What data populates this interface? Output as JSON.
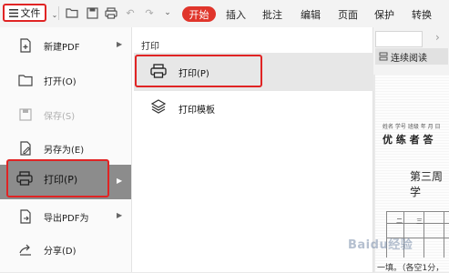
{
  "toolbar": {
    "file_label": "文件",
    "tabs": [
      "开始",
      "插入",
      "批注",
      "编辑",
      "页面",
      "保护",
      "转换"
    ],
    "icons": [
      "folder-icon",
      "save-icon",
      "print-icon",
      "undo-icon",
      "redo-icon",
      "dropdown-icon"
    ],
    "accent": "#e0352b"
  },
  "menu": {
    "items": [
      {
        "label": "新建PDF",
        "icon": "new-pdf-icon",
        "has_submenu": true
      },
      {
        "label": "打开(O)",
        "icon": "open-folder-icon",
        "has_submenu": false
      },
      {
        "label": "保存(S)",
        "icon": "save-icon",
        "has_submenu": false,
        "disabled": true
      },
      {
        "label": "另存为(E)",
        "icon": "save-as-icon",
        "has_submenu": false
      },
      {
        "label": "打印(P)",
        "icon": "print-icon",
        "has_submenu": true,
        "active": true
      },
      {
        "label": "导出PDF为",
        "icon": "export-pdf-icon",
        "has_submenu": true
      },
      {
        "label": "分享(D)",
        "icon": "share-icon",
        "has_submenu": false
      }
    ]
  },
  "submenu": {
    "title": "打印",
    "items": [
      {
        "label": "打印(P)",
        "icon": "print-icon",
        "highlighted": true
      },
      {
        "label": "打印模板",
        "icon": "layers-icon"
      }
    ]
  },
  "document": {
    "view_mode_label": "连续阅读",
    "header_small": "姓名 学号 班级 年 月 日",
    "header_title": "优 练 者 答",
    "heading": "第三周学",
    "grid_numbers": [
      "二",
      "三"
    ],
    "bottom_text": "一填。（各空1分，"
  },
  "watermark": "Baidu经验"
}
